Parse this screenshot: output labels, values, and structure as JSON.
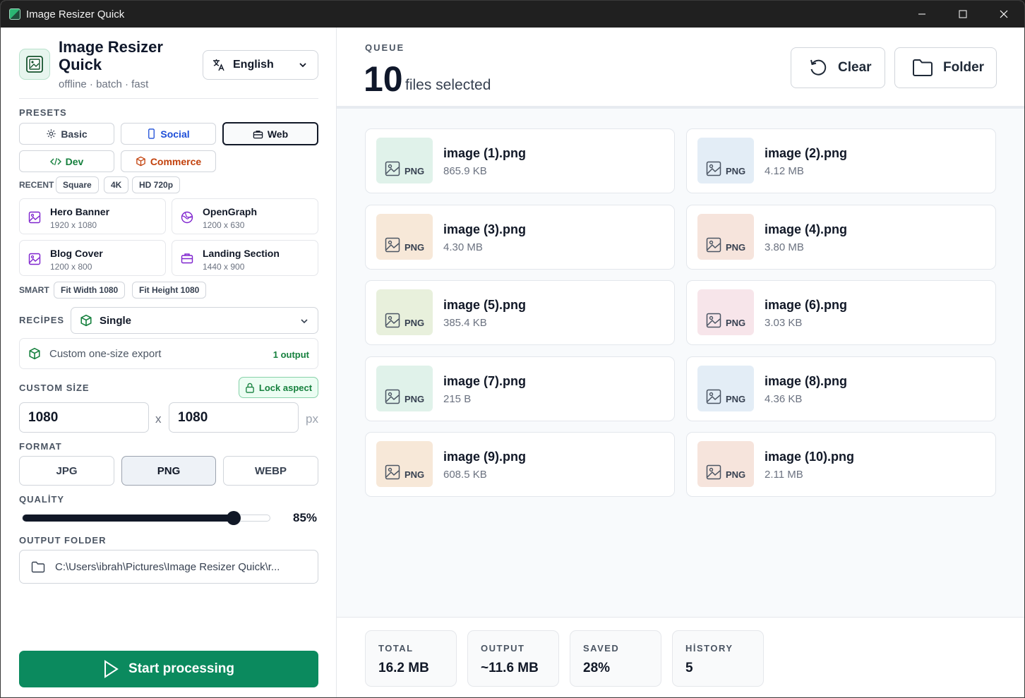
{
  "window": {
    "title": "Image Resizer Quick"
  },
  "sidebar": {
    "app_name": "Image Resizer Quick",
    "tagline": "offline · batch · fast",
    "language": "English",
    "presets_label": "PRESETS",
    "presets": [
      {
        "label": "Basic",
        "icon": "gear-icon",
        "color": "#374151"
      },
      {
        "label": "Social",
        "icon": "phone-icon",
        "color": "#1d4ed8"
      },
      {
        "label": "Web",
        "icon": "briefcase-icon",
        "color": "#111827",
        "active": true
      },
      {
        "label": "Dev",
        "icon": "code-icon",
        "color": "#15803d"
      },
      {
        "label": "Commerce",
        "icon": "box-icon",
        "color": "#c2410c"
      }
    ],
    "recent_label": "RECENT",
    "recent": [
      "Square",
      "4K",
      "HD 720p"
    ],
    "preset_cards": [
      {
        "name": "Hero Banner",
        "size": "1920 x 1080",
        "icon": "image-icon"
      },
      {
        "name": "OpenGraph",
        "size": "1200 x 630",
        "icon": "globe-icon"
      },
      {
        "name": "Blog Cover",
        "size": "1200 x 800",
        "icon": "image-icon"
      },
      {
        "name": "Landing Section",
        "size": "1440 x 900",
        "icon": "briefcase-icon"
      }
    ],
    "smart_label": "SMART",
    "smart": [
      "Fit Width 1080",
      "Fit Height 1080"
    ],
    "recipes_label": "RECİPES",
    "recipe_selected": "Single",
    "recipe_description": "Custom one-size export",
    "recipe_outputs": "1 output",
    "custom_size_label": "CUSTOM SİZE",
    "lock_aspect_label": "Lock aspect",
    "width": "1080",
    "height": "1080",
    "size_separator": "x",
    "unit": "px",
    "format_label": "FORMAT",
    "formats": [
      "JPG",
      "PNG",
      "WEBP"
    ],
    "format_selected": "PNG",
    "quality_label": "QUALİTY",
    "quality_value": "85%",
    "quality_fraction": 0.85,
    "output_folder_label": "OUTPUT FOLDER",
    "output_folder": "C:\\Users\\ibrah\\Pictures\\Image Resizer Quick\\r...",
    "start_label": "Start processing"
  },
  "queue": {
    "label": "QUEUE",
    "count": "10",
    "count_text": "files selected",
    "clear_label": "Clear",
    "folder_label": "Folder"
  },
  "files": [
    {
      "name": "image (1).png",
      "size": "865.9 KB",
      "ext": "PNG",
      "thumb_color": "#e0f2ea"
    },
    {
      "name": "image (2).png",
      "size": "4.12 MB",
      "ext": "PNG",
      "thumb_color": "#e3edf6"
    },
    {
      "name": "image (3).png",
      "size": "4.30 MB",
      "ext": "PNG",
      "thumb_color": "#f7e8d8"
    },
    {
      "name": "image (4).png",
      "size": "3.80 MB",
      "ext": "PNG",
      "thumb_color": "#f6e4dc"
    },
    {
      "name": "image (5).png",
      "size": "385.4 KB",
      "ext": "PNG",
      "thumb_color": "#e8f0dc"
    },
    {
      "name": "image (6).png",
      "size": "3.03 KB",
      "ext": "PNG",
      "thumb_color": "#f7e5ea"
    },
    {
      "name": "image (7).png",
      "size": "215 B",
      "ext": "PNG",
      "thumb_color": "#e0f2ea"
    },
    {
      "name": "image (8).png",
      "size": "4.36 KB",
      "ext": "PNG",
      "thumb_color": "#e3edf6"
    },
    {
      "name": "image (9).png",
      "size": "608.5 KB",
      "ext": "PNG",
      "thumb_color": "#f7e8d8"
    },
    {
      "name": "image (10).png",
      "size": "2.11 MB",
      "ext": "PNG",
      "thumb_color": "#f6e4dc"
    }
  ],
  "stats": [
    {
      "label": "TOTAL",
      "value": "16.2 MB"
    },
    {
      "label": "OUTPUT",
      "value": "~11.6 MB"
    },
    {
      "label": "SAVED",
      "value": "28%"
    },
    {
      "label": "HİSTORY",
      "value": "5"
    }
  ],
  "colors": {
    "accent": "#0b8a5e",
    "titlebar": "#202020"
  }
}
